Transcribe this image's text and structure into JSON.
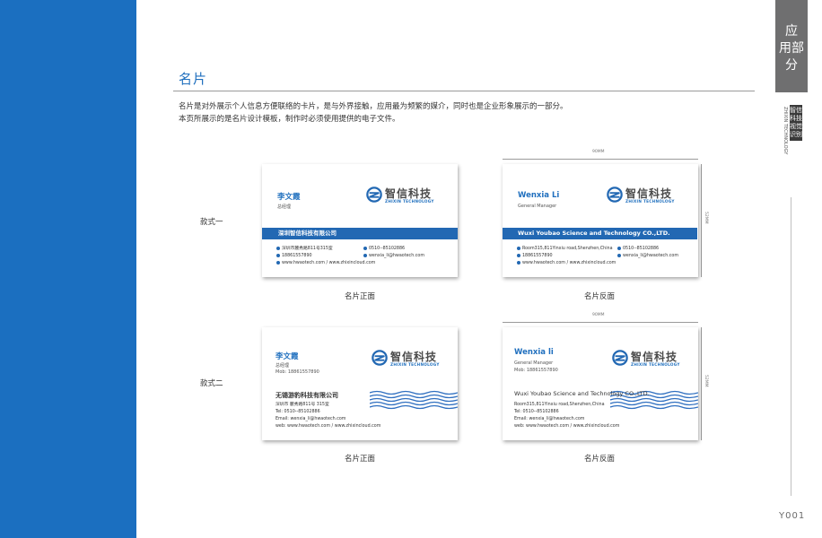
{
  "section": {
    "title": "名片",
    "desc1": "名片是对外展示个人信息方便联络的卡片，是与外界接触，应用最为频繁的媒介，同时也是企业形象展示的一部分。",
    "desc2": "本页所展示的是名片设计模板，制作时必须使用提供的电子文件。"
  },
  "side": {
    "tab_chars": [
      "应",
      "用",
      "部",
      "分"
    ],
    "vertical_cn": "智信科技视觉识别",
    "vertical_en": "ZHIXIN TECHNOLOGY",
    "page_number": "Y001"
  },
  "rows": [
    {
      "label": "款式一"
    },
    {
      "label": "款式二"
    }
  ],
  "captions": {
    "front": "名片正面",
    "back": "名片反面"
  },
  "dimensions": {
    "width": "90MM",
    "height": "52MM"
  },
  "logo": {
    "cn": "智信科技",
    "en": "ZHIXIN TECHNOLOGY"
  },
  "card1_front": {
    "name": "李文霞",
    "role": "总经理",
    "company": "深圳智信科技有限公司",
    "address": "深圳市麓秀路811号315室",
    "phone": "0510--85102886",
    "mobile": "18861557890",
    "email": "wenxia_li@hwaotech.com",
    "web": "www.hwaotech.com / www.zhixincloud.com"
  },
  "card1_back": {
    "name": "Wenxia Li",
    "role": "General Manager",
    "company": "Wuxi Youbao Science and Technology CO.,LTD.",
    "address": "Room315,811Yinxiu road,Shenzhen,China",
    "phone": "0510--85102886",
    "mobile": "18861557890",
    "email": "wenxia_li@hwaotech.com",
    "web": "www.hwaotech.com / www.zhixincloud.com"
  },
  "card2_front": {
    "name": "李文霞",
    "role": "总经理",
    "mobile": "Mob: 18861557890",
    "company": "无锡游豹科技有限公司",
    "address": "深圳市 麓秀路811号 315室",
    "tel": "Tel: 0510--85102886",
    "email": "Email: wenxia_li@hwaotech.com",
    "web": "web: www.hwaotech.com / www.zhixincloud.com"
  },
  "card2_back": {
    "name": "Wenxia li",
    "role": "General Manager",
    "mobile": "Mob: 18861557890",
    "company": "Wuxi Youbao Science and Technology CO.,LTD.",
    "address": "Room315,811Yinxiu road,Shenzhen,China",
    "tel": "Tel: 0510--85102886",
    "email": "Email: wenxia_li@hwaotech.com",
    "web": "web: www.hwaotech.com / www.zhixincloud.com"
  },
  "colors": {
    "brand_blue": "#1b6fc0",
    "tab_gray": "#6f6f70"
  }
}
